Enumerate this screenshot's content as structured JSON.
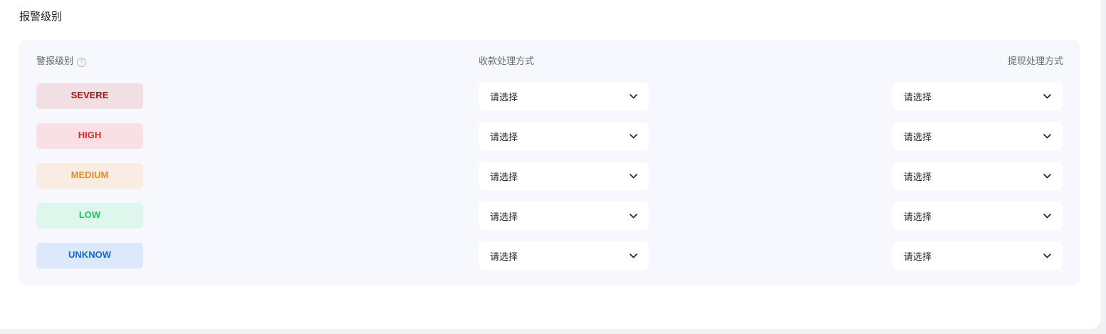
{
  "section_title": "报警级别",
  "table": {
    "headers": {
      "level": "警报级别",
      "level_help_icon": "question-circle-icon",
      "receipt": "收款处理方式",
      "withdraw": "提现处理方式"
    },
    "rows": [
      {
        "level": "SEVERE",
        "text_color": "#a8110f",
        "bg_color": "#f2dfe3",
        "receipt_value": "请选择",
        "withdraw_value": "请选择"
      },
      {
        "level": "HIGH",
        "text_color": "#ee2222",
        "bg_color": "#f8e0e4",
        "receipt_value": "请选择",
        "withdraw_value": "请选择"
      },
      {
        "level": "MEDIUM",
        "text_color": "#f08a1c",
        "bg_color": "#f9ece3",
        "receipt_value": "请选择",
        "withdraw_value": "请选择"
      },
      {
        "level": "LOW",
        "text_color": "#22c55e",
        "bg_color": "#dff6ec",
        "receipt_value": "请选择",
        "withdraw_value": "请选择"
      },
      {
        "level": "UNKNOW",
        "text_color": "#1666e0",
        "bg_color": "#dce9fd",
        "receipt_value": "请选择",
        "withdraw_value": "请选择"
      }
    ]
  },
  "colors": {
    "panel_bg": "#f7f8fd",
    "header_text": "#646a73"
  }
}
